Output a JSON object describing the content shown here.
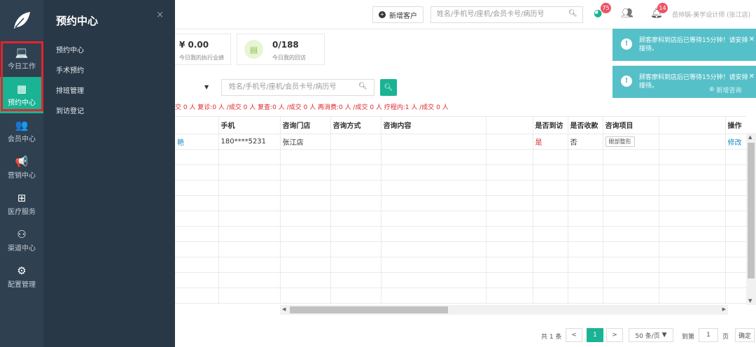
{
  "sidebar": {
    "items": [
      {
        "label": "今日工作",
        "icon": "laptop-icon",
        "glyph": "💻"
      },
      {
        "label": "预约中心",
        "icon": "calendar-icon",
        "glyph": "▦"
      },
      {
        "label": "会员中心",
        "icon": "users-icon",
        "glyph": "👥"
      },
      {
        "label": "营销中心",
        "icon": "bullhorn-icon",
        "glyph": "📢"
      },
      {
        "label": "医疗服务",
        "icon": "medkit-icon",
        "glyph": "⊞"
      },
      {
        "label": "渠道中心",
        "icon": "sitemap-icon",
        "glyph": "⚇"
      },
      {
        "label": "配置管理",
        "icon": "gear-icon",
        "glyph": "⚙"
      }
    ],
    "active_index": 1
  },
  "submenu": {
    "title": "预约中心",
    "close": "×",
    "items": [
      "预约中心",
      "手术预约",
      "排班管理",
      "到访登记"
    ]
  },
  "topbar": {
    "add_customer": "新增客户",
    "search_placeholder": "姓名/手机号/座机/会员卡号/病历号",
    "wechat_badge": "75",
    "bell_badge": "14",
    "user": "岳帅锅-美学设计师 (张江店)"
  },
  "stats": [
    {
      "value": "¥ 0.00",
      "label": "今日我的执行业绩"
    },
    {
      "value": "0/188",
      "label": "今日我的回访"
    }
  ],
  "filter": {
    "search_placeholder": "姓名/手机号/座机/会员卡号/病历号",
    "summary": "交 0 人   复诊:0 人 /成交 0 人   复查:0 人 /成交 0 人   再消费:0 人 /成交 0 人   疗程内:1 人 /成交 0 人"
  },
  "table": {
    "columns": [
      "",
      "手机",
      "咨询门店",
      "咨询方式",
      "咨询内容",
      "",
      "是否到访",
      "是否收款",
      "咨询项目",
      "",
      "操作"
    ],
    "rows": [
      {
        "name": "艳",
        "phone": "180****5231",
        "store": "张江店",
        "method": "",
        "content": "",
        "visited": "是",
        "paid": "否",
        "project": "眼部整形",
        "action": "修改"
      }
    ]
  },
  "pager": {
    "total": "共 1 条",
    "prev": "<",
    "page": "1",
    "next": ">",
    "page_size": "50 条/页",
    "goto_label": "到第",
    "goto_value": "1",
    "page_label": "页",
    "confirm": "确定"
  },
  "toasts": [
    {
      "message": "顾客廖科到店后已等待15分钟！请安排接待。"
    },
    {
      "message": "顾客廖科到店后已等待15分钟！请安排接待。"
    }
  ],
  "ghost_button": "新增咨询",
  "colors": {
    "accent": "#1ab394",
    "sidebar": "#2f4050",
    "submenu": "#293846",
    "toast": "#56c0c9",
    "alert": "#e0262c"
  }
}
